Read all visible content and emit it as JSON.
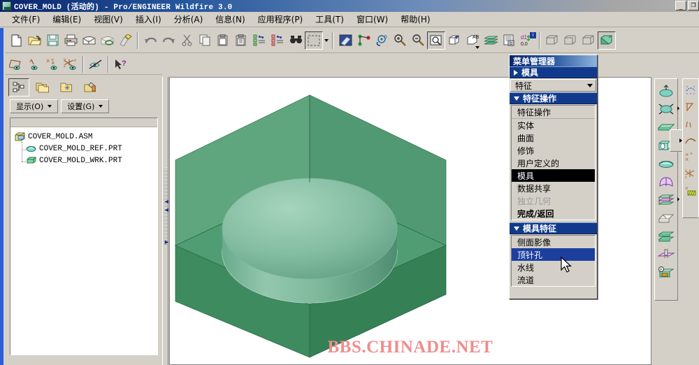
{
  "window": {
    "title": "COVER_MOLD (活动的) - Pro/ENGINEER Wildfire 3.0",
    "icon": "mold-part-icon",
    "buttons": [
      {
        "name": "minimize-button",
        "glyph": "_"
      },
      {
        "name": "maximize-button",
        "glyph": "❐"
      }
    ],
    "titlebar_color": "#0a246a"
  },
  "menubar": {
    "items": [
      {
        "name": "menu-file",
        "label": "文件(F)"
      },
      {
        "name": "menu-edit",
        "label": "编辑(E)"
      },
      {
        "name": "menu-view",
        "label": "视图(V)"
      },
      {
        "name": "menu-insert",
        "label": "插入(I)"
      },
      {
        "name": "menu-analysis",
        "label": "分析(A)"
      },
      {
        "name": "menu-info",
        "label": "信息(N)"
      },
      {
        "name": "menu-application",
        "label": "应用程序(P)"
      },
      {
        "name": "menu-tools",
        "label": "工具(T)"
      },
      {
        "name": "menu-window",
        "label": "窗口(W)"
      },
      {
        "name": "menu-help",
        "label": "帮助(H)"
      }
    ]
  },
  "toolbar_main": {
    "groups": [
      [
        "new-icon",
        "open-icon",
        "save-icon",
        "print-icon",
        "mail-icon",
        "mail-link-icon",
        "erase-icon"
      ],
      [
        "undo-icon",
        "redo-icon",
        "cut-icon",
        "copy-icon",
        "paste-icon",
        "paste-special-icon",
        "regenerate-icon",
        "regenerate-model-icon",
        "find-icon",
        "select-box-icon"
      ],
      [
        "repaint-icon",
        "datum-display-icon",
        "spin-center-icon",
        "zoom-in-icon",
        "zoom-out-icon",
        "refit-icon",
        "saved-view-icon",
        "view-annotation-icon",
        "layer-icon",
        "model-player-icon",
        "dim-tolerance-icon"
      ],
      [
        "wireframe-icon",
        "hidden-line-icon",
        "no-hidden-icon",
        "shading-icon"
      ]
    ]
  },
  "toolbar_datum": {
    "groups": [
      [
        "datum-plane-icon",
        "datum-axis-icon",
        "datum-point-icon",
        "datum-csys-icon"
      ],
      [
        "annotation-off-icon"
      ],
      [
        "context-help-icon"
      ]
    ]
  },
  "navigator": {
    "tabs": [
      {
        "name": "model-tree-tab",
        "icon": "model-tree-icon",
        "active": true
      },
      {
        "name": "folder-browser-tab",
        "icon": "folder-browser-icon",
        "active": false
      },
      {
        "name": "favorites-tab",
        "icon": "favorites-folder-icon",
        "active": false
      },
      {
        "name": "connections-tab",
        "icon": "connections-icon",
        "active": false
      }
    ],
    "dropdowns": [
      {
        "name": "show-dropdown",
        "label": "显示(O)"
      },
      {
        "name": "settings-dropdown",
        "label": "设置(G)"
      }
    ],
    "tree": [
      {
        "name": "tree-item-assembly",
        "label": "COVER_MOLD.ASM",
        "icon": "assembly-icon",
        "indent": 0
      },
      {
        "name": "tree-item-ref-part",
        "label": "COVER_MOLD_REF.PRT",
        "icon": "ref-part-icon",
        "indent": 1
      },
      {
        "name": "tree-item-wrk-part",
        "label": "COVER_MOLD_WRK.PRT",
        "icon": "wrk-part-icon",
        "indent": 1
      }
    ]
  },
  "graphics": {
    "watermark": "BBS.CHINADE.NET",
    "watermark_color": "#f08d8d",
    "background": "#ffffff",
    "model_color": "#3f8f62",
    "model_boss_color": "#76b593"
  },
  "menu_manager": {
    "title": "菜单管理器",
    "sections": [
      {
        "name": "mold-group-header",
        "kind": "header-collapsed",
        "label": "模具"
      },
      {
        "name": "feature-combo",
        "kind": "combo",
        "label": "特征"
      },
      {
        "name": "feature-ops-group-header",
        "kind": "header-expanded",
        "label": "特征操作"
      },
      {
        "name": "feature-ops-panel",
        "kind": "panel",
        "subtitle": "特征操作",
        "items": [
          {
            "name": "mm-item-solid",
            "label": "实体",
            "state": "normal"
          },
          {
            "name": "mm-item-surface",
            "label": "曲面",
            "state": "normal"
          },
          {
            "name": "mm-item-cosmetic",
            "label": "修饰",
            "state": "normal"
          },
          {
            "name": "mm-item-user-defined",
            "label": "用户定义的",
            "state": "normal"
          },
          {
            "name": "mm-item-mold",
            "label": "模具",
            "state": "selected-black"
          },
          {
            "name": "mm-item-data-sharing",
            "label": "数据共享",
            "state": "normal"
          },
          {
            "name": "mm-item-indep-geom",
            "label": "独立几何",
            "state": "disabled"
          },
          {
            "name": "mm-item-done-return",
            "label": "完成/返回",
            "state": "bold"
          }
        ]
      },
      {
        "name": "mold-feature-group-header",
        "kind": "header-expanded",
        "label": "模具特征"
      },
      {
        "name": "mold-feature-panel",
        "kind": "panel",
        "subtitle": null,
        "items": [
          {
            "name": "mm-item-silhouette",
            "label": "侧面影像",
            "state": "normal"
          },
          {
            "name": "mm-item-ejector-pin",
            "label": "顶针孔",
            "state": "selected-blue"
          },
          {
            "name": "mm-item-waterline",
            "label": "水线",
            "state": "normal"
          },
          {
            "name": "mm-item-runner",
            "label": "流道",
            "state": "normal"
          }
        ]
      }
    ]
  },
  "right_toolbar": {
    "buttons": [
      {
        "name": "extrude-icon",
        "flyout": false
      },
      {
        "name": "revolve-icon",
        "flyout": true
      },
      {
        "name": "sweep-blend-icon",
        "flyout": false
      },
      {
        "name": "hole-icon",
        "flyout": true
      },
      {
        "name": "round-icon",
        "flyout": false
      },
      {
        "name": "shell-icon",
        "flyout": false
      },
      {
        "name": "rib-icon",
        "flyout": true
      },
      {
        "name": "draft-icon",
        "flyout": false
      },
      {
        "name": "pattern-icon",
        "flyout": false
      },
      {
        "name": "mirror-icon",
        "flyout": false
      },
      {
        "name": "model-player-icon",
        "flyout": false
      }
    ]
  },
  "right_toolbar_2": {
    "buttons": [
      {
        "name": "sketch-grid-icon"
      },
      {
        "name": "sketch-line-icon"
      },
      {
        "name": "sketch-arc-icon"
      },
      {
        "name": "sketch-spline-icon"
      },
      {
        "name": "sketch-point-icon"
      },
      {
        "name": "sketch-csys-icon"
      },
      {
        "name": "sketch-hatch-icon"
      }
    ]
  }
}
